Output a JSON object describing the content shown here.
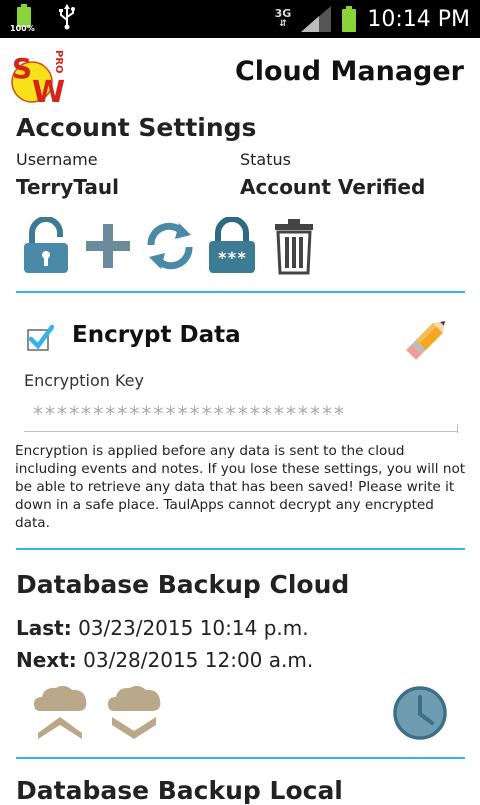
{
  "status_bar": {
    "battery_left_text": "100%",
    "network": "3G",
    "time": "10:14 PM"
  },
  "header": {
    "logo_letters": [
      "S",
      "W"
    ],
    "logo_badge": "PRO",
    "title": "Cloud Manager"
  },
  "account": {
    "section_title": "Account Settings",
    "username_label": "Username",
    "username_value": "TerryTaul",
    "status_label": "Status",
    "status_value": "Account Verified",
    "actions": [
      "unlock-icon",
      "add-icon",
      "sync-icon",
      "password-lock-icon",
      "trash-icon"
    ]
  },
  "encryption": {
    "checkbox_checked": true,
    "label": "Encrypt Data",
    "key_label": "Encryption Key",
    "key_value": "**************************",
    "info": "Encryption is applied before any data is sent to the cloud including events and notes.  If you lose these settings, you will not be able to retrieve any data that has been saved! Please write it down in a safe place. TaulApps cannot decrypt any encrypted data."
  },
  "backup_cloud": {
    "section_title": "Database Backup Cloud",
    "last_label": "Last:",
    "last_value": "03/23/2015 10:14 p.m.",
    "next_label": "Next:",
    "next_value": "03/28/2015 12:00 a.m."
  },
  "backup_local": {
    "section_title": "Database Backup Local"
  },
  "colors": {
    "accent": "#33b5e5",
    "icon_teal": "#3d7a93",
    "cloud_tan": "#b9a98a"
  }
}
